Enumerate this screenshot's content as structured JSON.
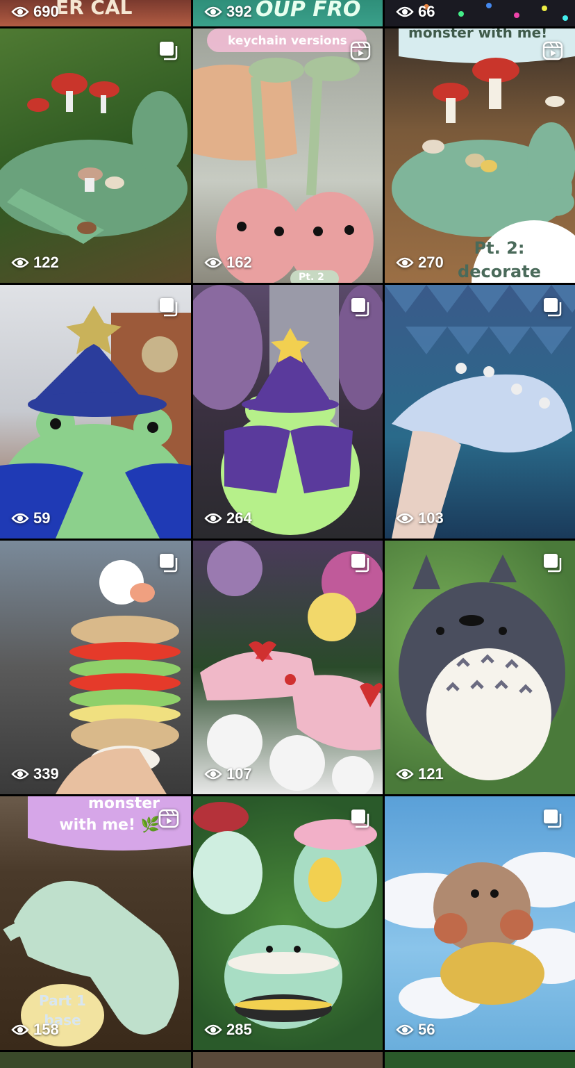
{
  "tiles": [
    {
      "views": "690",
      "badge": "none"
    },
    {
      "views": "392",
      "badge": "none",
      "caption": "OUP FRO"
    },
    {
      "views": "66",
      "badge": "none"
    },
    {
      "views": "122",
      "badge": "multi-photo-icon"
    },
    {
      "views": "162",
      "badge": "reel-icon",
      "caption_top": "keychain versions",
      "caption_bottom": "Pt. 2"
    },
    {
      "views": "270",
      "badge": "reel-icon",
      "caption_top": "monster with me!",
      "caption_bottom": "Pt. 2: decorate"
    },
    {
      "views": "59",
      "badge": "multi-photo-icon"
    },
    {
      "views": "264",
      "badge": "multi-photo-icon"
    },
    {
      "views": "103",
      "badge": "multi-photo-icon"
    },
    {
      "views": "339",
      "badge": "multi-photo-icon"
    },
    {
      "views": "107",
      "badge": "multi-photo-icon"
    },
    {
      "views": "121",
      "badge": "multi-photo-icon"
    },
    {
      "views": "158",
      "badge": "reel-icon",
      "caption_top": "monster with me! 🌿",
      "caption_bottom": "Part 1 base"
    },
    {
      "views": "285",
      "badge": "multi-photo-icon"
    },
    {
      "views": "56",
      "badge": "multi-photo-icon"
    }
  ],
  "colors": {
    "grid_gap": "#000000",
    "view_text": "#ffffff"
  }
}
